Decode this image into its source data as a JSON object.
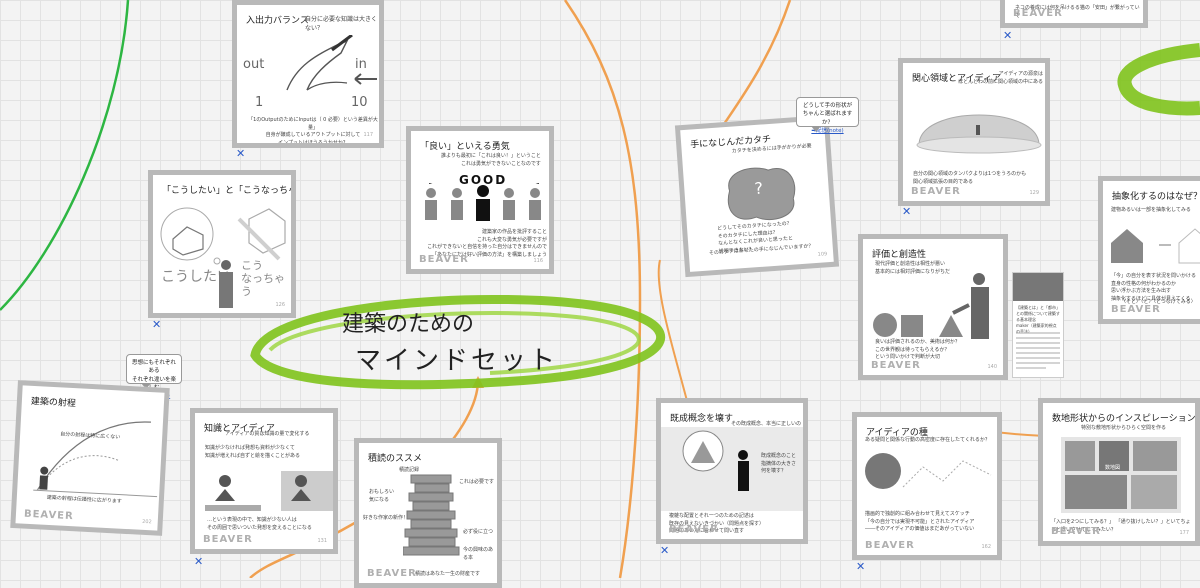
{
  "canvas": {
    "central_node": {
      "line1": "建築のための",
      "line2": "マインドセット"
    }
  },
  "cards": [
    {
      "id": "io",
      "title": "入出力バランス",
      "subtitle": "自分に必要な知識は大きくない？",
      "text": "「1のOutputのためにInputは（ 0 必要）という差異が大量」\n自身が醸成しているアウトプットに対して\nインプットはほうろうかせか？",
      "labels": [
        "out",
        "in",
        "1",
        "10"
      ],
      "brand": "",
      "page": "117"
    },
    {
      "id": "top-right",
      "title": "",
      "text": "ネコの養成には何を吊けるる猫の「安田」が繋がっていて",
      "brand": "BEAVER",
      "page": ""
    },
    {
      "id": "courage",
      "title": "「良い」といえる勇気",
      "text": "誰よりも最初に「これは良い！」ということ\nこれは勇気ができないことなのです",
      "text2": "建築家の作品を批評すること\nこれも大変な勇気が必要ですが\nこれができないと自信を持った自分はできませんので\n「あなたにだけ好い評価の方法」を構築しましょう",
      "good": "GOOD",
      "brand": "BEAVER",
      "page": "116"
    },
    {
      "id": "want",
      "title": "「こうしたい」と「こうなっちゃう」",
      "hand1": "こうしたい",
      "hand2": "こう\nなっちゃう",
      "brand": "BEAVER",
      "page": "126"
    },
    {
      "id": "katachi",
      "title": "手になじんだカタチ",
      "subtitle": "カタチを決めるには手がかりが必要",
      "q": "?",
      "text": "どうしてそのカタチになったの？\nそのカタチにした理由は？\nなんとなくこれが良いと思ったと\n説明できない？",
      "text2": "そのカタチはあなたの手になじんでいますか？",
      "brand": "BEAVER",
      "page": "109"
    },
    {
      "id": "interest",
      "title": "関心領域とアイディア",
      "subtitle": "アイディアの源泉は\nほとんどわの前に関心領域の中にある",
      "text": "自分の関心領域の外にアイディアを探す",
      "text2": "自分の関心領域の中にアイディアを探す",
      "text3": "自分の関心領域のタンパクよりは1つをうろのかも\n関心領域拡張の目的である",
      "brand": "BEAVER",
      "page": "129"
    },
    {
      "id": "abstract",
      "title": "抽象化するのはなぜ？",
      "subtitle": "建物あるいは一部を抽象化してみる",
      "text": "「今」の自分を表す状況を問いかける\n直身の性格の何がわかるのか\n思い浮かぶ方法を生み出す\n抽象化するほどに具体が見えてくる",
      "text2": "〈そと〉〈と〉〈とつなげてみる〉",
      "brand": "BEAVER",
      "page": ""
    },
    {
      "id": "eval",
      "title": "評価と創造性",
      "text": "現代評価と創造性は相性が悪い\n基本的には相対評価になりがちだ",
      "text2": "良いは評価されるのか、美術は何か？\nこの世界観は待ってもらえるか？\nという問いかけで判断が大切",
      "brand": "BEAVER",
      "page": "140"
    },
    {
      "id": "cognition",
      "title": "既成概念を壊す",
      "subtitle": "その既成概念、本当に正しいのか？",
      "text": "既成概念のこと\n指摘体の大きさ\n何を壊す？",
      "text2": "複雑な配置とそれ一つのための記述は\n既存の見えないきづかい（問題点を探す）\n問題のあいだに合わせて問い直す",
      "brand": "BEAVER",
      "page": ""
    },
    {
      "id": "seed",
      "title": "アイディアの種",
      "subtitle": "ある疑問と関係な行動の高密度に存在したてくれるか？",
      "text": "自分の力で初めて組み合わせて見る可能性",
      "text2": "描画的で独創的に組み合わせて見えてスケッチ\n「今の自分では実現不可能」とされたアイディア\n――そのアイディアの価値はまだあがっていない",
      "brand": "BEAVER",
      "page": "162"
    },
    {
      "id": "numbers",
      "title": "数地形状からのインスピレーション",
      "subtitle": "特別な敷地形状からひらく空間を作る",
      "text": "数地図",
      "text2": "「入口を2つにしてみる？」 「通り抜けしたい？」といてちょっと違いさせてしてみたい？",
      "brand": "BEAVER",
      "page": "177"
    },
    {
      "id": "trajectory",
      "title": "建築の射程",
      "text": "自分の射程は特に広くない",
      "text2": "建築の射程は伝播性に広がります",
      "brand": "BEAVER",
      "page": "202"
    },
    {
      "id": "knowledge",
      "title": "知識とアイディア",
      "subtitle": "アイディアの質は知識の量で変化する",
      "text": "知識が少なければ発想も資料が少なくて\n知識が増えれば自ずと絵を描くことがある",
      "text2": "…という表現の中で、知識が少ない人は\nその周囲で思いついた発想を変えることになる",
      "brand": "BEAVER",
      "page": "131"
    },
    {
      "id": "study",
      "title": "積読のススメ",
      "labels": [
        "積読記録",
        "おもしろい\n気になる",
        "これは必要です",
        "好きな作家の新作！",
        "どこに置こうか",
        "必ず役に立つ",
        "今の興味のある本"
      ],
      "text": "積読はあなた一生の財産です",
      "brand": "BEAVER",
      "page": ""
    }
  ],
  "notes": [
    {
      "id": "note-katachi",
      "text": "どうして手の形状が\nちゃんと選ばれますか？",
      "link": "➡配信(note)"
    },
    {
      "id": "note-trajectory",
      "text": "思想にもそれぞれある\nそれぞれ違いを楽しむ",
      "link": "➡配信(note)"
    }
  ],
  "side_thumb": {
    "text": "【建築とは」と「都市」との関係について建築する基本理念\nmaker（建築家的視点の手法）"
  },
  "delete_label": "✕",
  "colors": {
    "green": "#7fc31c",
    "orange": "#f0a050",
    "leftgreen": "#2db642",
    "link": "#2a5ac8",
    "card_border": "#b9b9b9"
  }
}
